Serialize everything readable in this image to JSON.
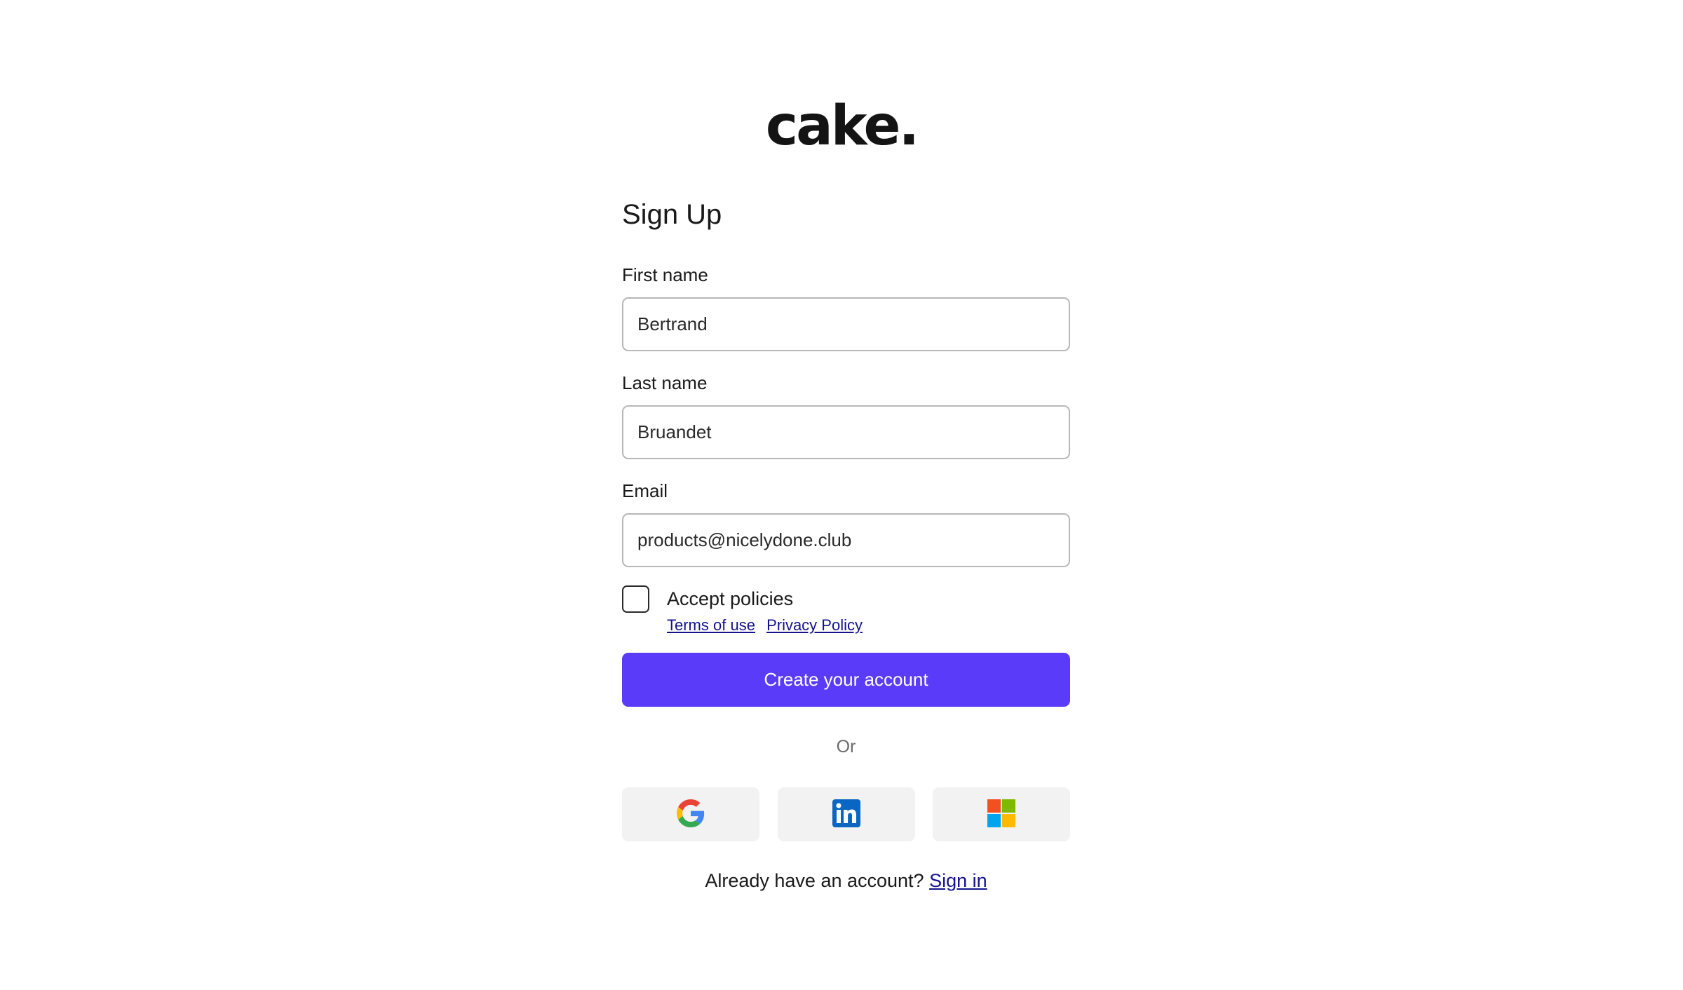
{
  "brand": {
    "logo_text": "cake."
  },
  "signup": {
    "title": "Sign Up",
    "first_name": {
      "label": "First name",
      "value": "Bertrand"
    },
    "last_name": {
      "label": "Last name",
      "value": "Bruandet"
    },
    "email": {
      "label": "Email",
      "value": "products@nicelydone.club"
    },
    "policies": {
      "label": "Accept policies",
      "checked": false,
      "terms_link": "Terms of use",
      "privacy_link": "Privacy Policy"
    },
    "submit_label": "Create your account",
    "divider_text": "Or",
    "social": [
      {
        "name": "google",
        "icon": "google-icon"
      },
      {
        "name": "linkedin",
        "icon": "linkedin-icon"
      },
      {
        "name": "microsoft",
        "icon": "microsoft-icon"
      }
    ],
    "signin_prompt": "Already have an account?",
    "signin_link": "Sign in"
  },
  "colors": {
    "primary": "#5a3bfa",
    "link": "#14128c",
    "social_bg": "#f2f2f2",
    "input_border": "#b7b7b7"
  }
}
